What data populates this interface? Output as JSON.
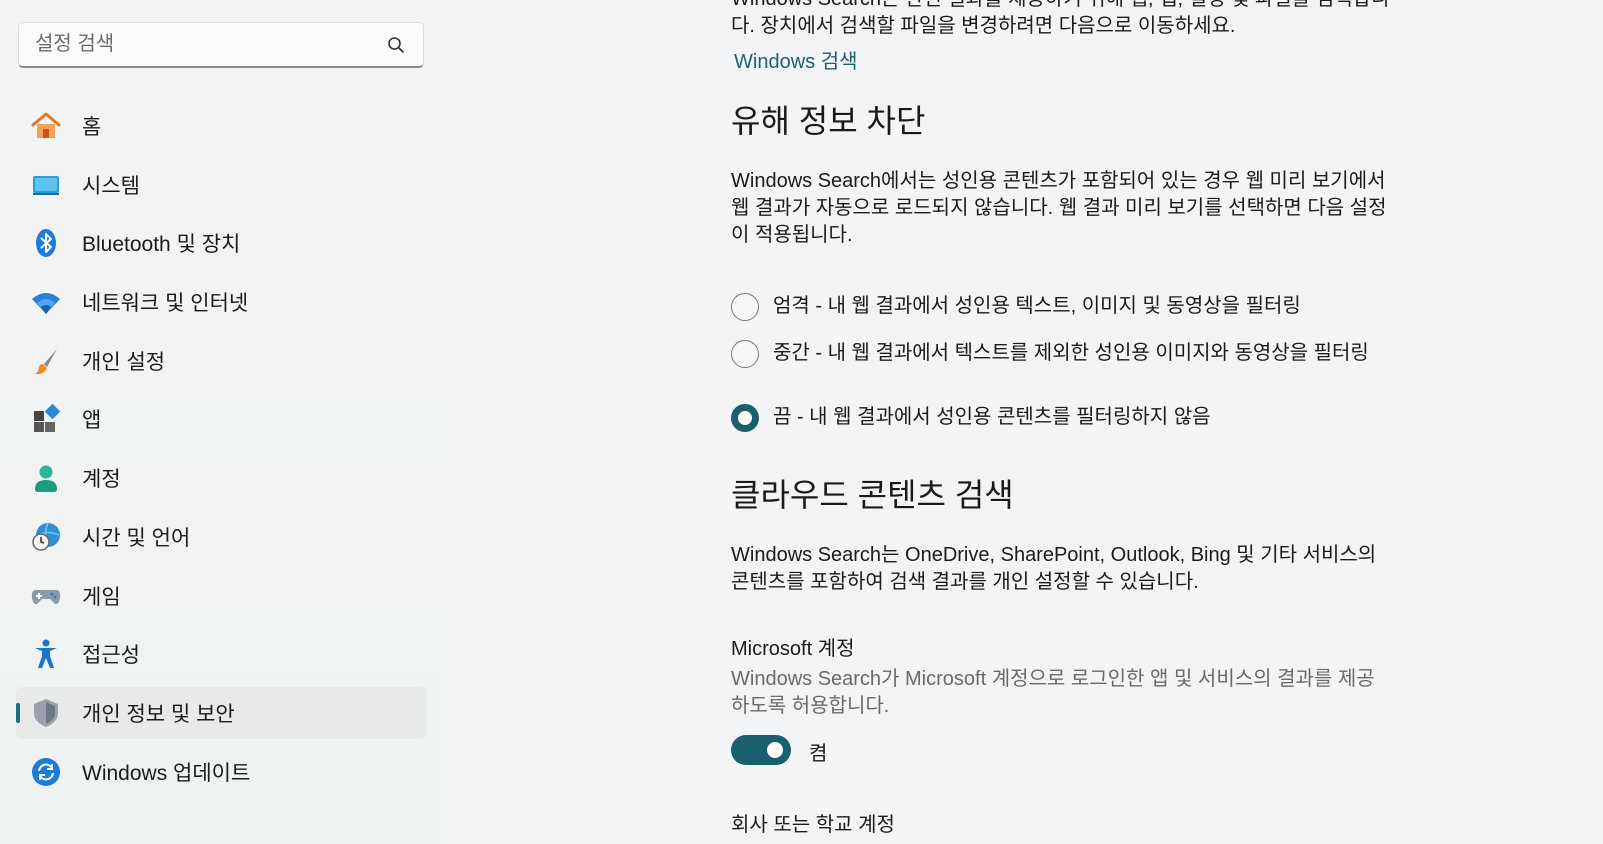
{
  "sidebar": {
    "search_placeholder": "설정 검색",
    "items": [
      {
        "label": "홈",
        "icon": "home-icon"
      },
      {
        "label": "시스템",
        "icon": "system-icon"
      },
      {
        "label": "Bluetooth 및 장치",
        "icon": "bluetooth-icon"
      },
      {
        "label": "네트워크 및 인터넷",
        "icon": "wifi-icon"
      },
      {
        "label": "개인 설정",
        "icon": "brush-icon"
      },
      {
        "label": "앱",
        "icon": "apps-icon"
      },
      {
        "label": "계정",
        "icon": "account-icon"
      },
      {
        "label": "시간 및 언어",
        "icon": "time-language-icon"
      },
      {
        "label": "게임",
        "icon": "gamepad-icon"
      },
      {
        "label": "접근성",
        "icon": "accessibility-icon"
      },
      {
        "label": "개인 정보 및 보안",
        "icon": "shield-icon",
        "active": true
      },
      {
        "label": "Windows 업데이트",
        "icon": "update-icon"
      }
    ]
  },
  "main": {
    "intro_text": "Windows Search는 관련 결과를 제공하기 위해 웹, 앱, 설정 및 파일을 검색합니다. 장치에서 검색할 파일을 변경하려면 다음으로 이동하세요.",
    "intro_link": "Windows 검색",
    "safe_search": {
      "heading": "유해 정보 차단",
      "description": "Windows Search에서는 성인용 콘텐츠가 포함되어 있는 경우 웹 미리 보기에서 웹 결과가 자동으로 로드되지 않습니다. 웹 결과 미리 보기를 선택하면 다음 설정이 적용됩니다.",
      "options": [
        {
          "label": "엄격 - 내 웹 결과에서 성인용 텍스트, 이미지 및 동영상을 필터링",
          "checked": false
        },
        {
          "label": "중간 - 내 웹 결과에서 텍스트를 제외한 성인용 이미지와 동영상을 필터링",
          "checked": false
        },
        {
          "label": "끔 - 내 웹 결과에서 성인용 콘텐츠를 필터링하지 않음",
          "checked": true
        }
      ]
    },
    "cloud_search": {
      "heading": "클라우드 콘텐츠 검색",
      "description": "Windows Search는 OneDrive, SharePoint, Outlook, Bing 및 기타 서비스의 콘텐츠를 포함하여 검색 결과를 개인 설정할 수 있습니다.",
      "ms_account": {
        "title": "Microsoft 계정",
        "description": "Windows Search가 Microsoft 계정으로 로그인한 앱 및 서비스의 결과를 제공하도록 허용합니다.",
        "toggle_state": "켬",
        "toggle_on": true
      },
      "work_account_title": "회사 또는 학교 계정"
    }
  },
  "colors": {
    "accent": "#1c5f6c",
    "link": "#1f5f6e"
  }
}
